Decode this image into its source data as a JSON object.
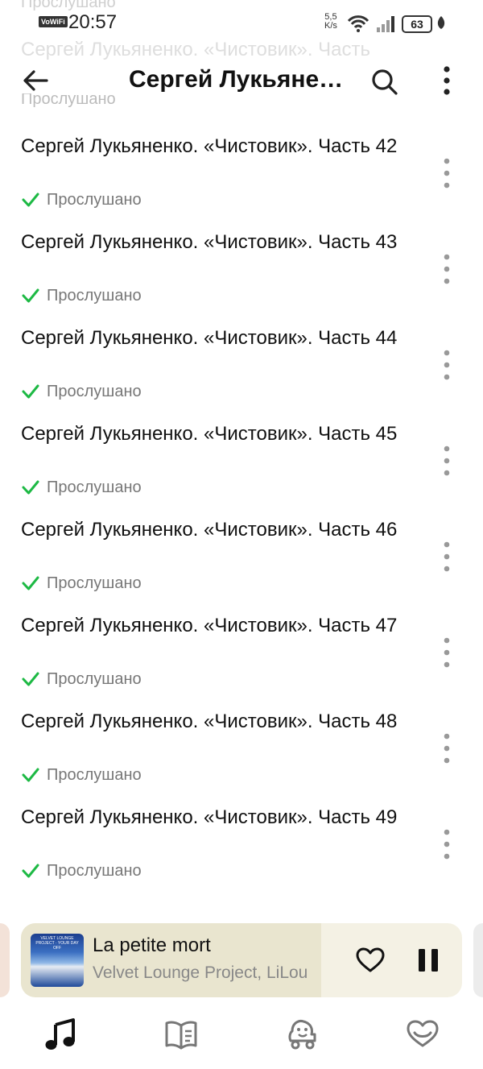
{
  "status_bar": {
    "vowifi": "VoWiFi",
    "time": "20:57",
    "speed_value": "5,5",
    "speed_unit": "K/s",
    "battery": "63"
  },
  "ghost": {
    "top_status": "Прослушано",
    "title": "Сергей Лукьяненко. «Чистовик». Часть",
    "status": "Прослушано"
  },
  "header": {
    "title": "Сергей Лукьяненко. «Чистовик»"
  },
  "episodes": [
    {
      "title": "Сергей Лукьяненко. «Чистовик». Часть 42",
      "status": "Прослушано"
    },
    {
      "title": "Сергей Лукьяненко. «Чистовик». Часть 43",
      "status": "Прослушано"
    },
    {
      "title": "Сергей Лукьяненко. «Чистовик». Часть 44",
      "status": "Прослушано"
    },
    {
      "title": "Сергей Лукьяненко. «Чистовик». Часть 45",
      "status": "Прослушано"
    },
    {
      "title": "Сергей Лукьяненко. «Чистовик». Часть 46",
      "status": "Прослушано"
    },
    {
      "title": "Сергей Лукьяненко. «Чистовик». Часть 47",
      "status": "Прослушано"
    },
    {
      "title": "Сергей Лукьяненко. «Чистовик». Часть 48",
      "status": "Прослушано"
    },
    {
      "title": "Сергей Лукьяненко. «Чистовик». Часть 49",
      "status": "Прослушано"
    }
  ],
  "player": {
    "cover_text": "VELVET LOUNGE PROJECT · YOUR DAY OFF",
    "title": "La petite mort",
    "artist": "Velvet Lounge Project, LiLou",
    "progress": 0.68
  },
  "nav": {
    "items": [
      "music-note-icon",
      "book-icon",
      "kids-icon",
      "heart-icon"
    ],
    "active": 0
  },
  "colors": {
    "check": "#1db944",
    "status_text": "#777777",
    "player_bg": "#f4f1e4",
    "player_progress": "#e9e5cf"
  }
}
